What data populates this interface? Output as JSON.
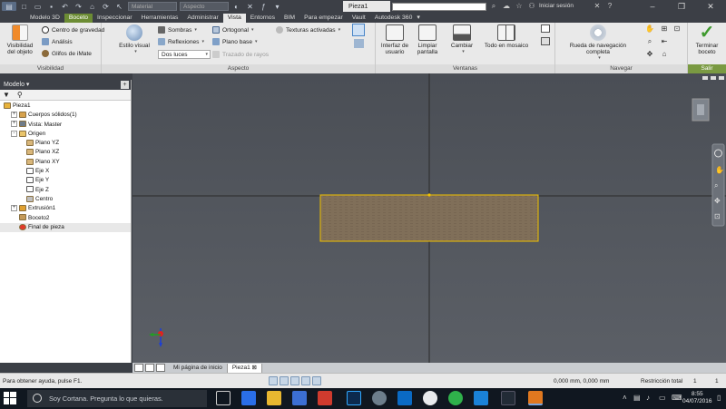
{
  "titlebar": {
    "material": "Material",
    "aspecto": "Aspecto",
    "document_tab": "Pieza1",
    "signin": "Iniciar sesión"
  },
  "ribbon_tabs": [
    "Modelo 3D",
    "Boceto",
    "Inspeccionar",
    "Herramientas",
    "Administrar",
    "Vista",
    "Entornos",
    "BIM",
    "Para empezar",
    "Vault",
    "Autodesk 360"
  ],
  "ribbon": {
    "visibilidad": {
      "title": "Visibilidad",
      "big": "Visibilidad del objeto",
      "small": [
        "Centro de gravedad",
        "Análisis",
        "Glifos de iMate"
      ]
    },
    "aspecto": {
      "title": "Aspecto",
      "estilo_visual": "Estilo visual",
      "sombras": "Sombras",
      "reflexiones": "Reflexiones",
      "dos_luces": "Dos luces",
      "ortogonal": "Ortogonal",
      "plano_base": "Plano base",
      "trazado": "Trazado de rayos",
      "texturas": "Texturas activadas"
    },
    "ventanas": {
      "title": "Ventanas",
      "interfaz": "Interfaz de usuario",
      "limpiar": "Limpiar pantalla",
      "cambiar": "Cambiar",
      "todo_mosaico": "Todo en mosaico"
    },
    "navegar": {
      "title": "Navegar",
      "rueda": "Rueda de navegación completa"
    },
    "salir": {
      "title": "Salir",
      "terminar": "Terminar boceto"
    }
  },
  "browser": {
    "title": "Modelo",
    "tree": [
      {
        "label": "Pieza1",
        "level": 0,
        "icon": "part-icon",
        "toggle": ""
      },
      {
        "label": "Cuerpos sólidos(1)",
        "level": 1,
        "icon": "solid-bodies-icon",
        "toggle": "+"
      },
      {
        "label": "Vista: Master",
        "level": 1,
        "icon": "view-icon",
        "toggle": "+"
      },
      {
        "label": "Origen",
        "level": 1,
        "icon": "origin-folder-icon",
        "toggle": "-"
      },
      {
        "label": "Plano YZ",
        "level": 2,
        "icon": "plane-icon",
        "toggle": ""
      },
      {
        "label": "Plano XZ",
        "level": 2,
        "icon": "plane-icon",
        "toggle": ""
      },
      {
        "label": "Plano XY",
        "level": 2,
        "icon": "plane-icon",
        "toggle": ""
      },
      {
        "label": "Eje X",
        "level": 2,
        "icon": "axis-icon",
        "toggle": ""
      },
      {
        "label": "Eje Y",
        "level": 2,
        "icon": "axis-icon",
        "toggle": ""
      },
      {
        "label": "Eje Z",
        "level": 2,
        "icon": "axis-icon",
        "toggle": ""
      },
      {
        "label": "Centro",
        "level": 2,
        "icon": "center-point-icon",
        "toggle": ""
      },
      {
        "label": "Extrusión1",
        "level": 1,
        "icon": "extrusion-icon",
        "toggle": "+"
      },
      {
        "label": "Boceto2",
        "level": 1,
        "icon": "sketch-icon",
        "toggle": ""
      },
      {
        "label": "Final de pieza",
        "level": 1,
        "icon": "end-of-part-icon",
        "toggle": ""
      }
    ]
  },
  "viewport_tabs": [
    "Mi página de inicio",
    "Pieza1"
  ],
  "status": {
    "help": "Para obtener ayuda, pulse F1.",
    "coords": "0,000 mm, 0,000 mm",
    "constraint": "Restricción total",
    "n1": "1",
    "n2": "1"
  },
  "taskbar": {
    "cortana": "Soy Cortana. Pregunta lo que quieras.",
    "time": "8:55",
    "date": "04/07/2016"
  },
  "colors": {
    "accent": "#f2c200",
    "part_fill": "#7b6a55",
    "ribbon_bg": "#e9e9e9",
    "viewport_bg": "#53575e"
  }
}
